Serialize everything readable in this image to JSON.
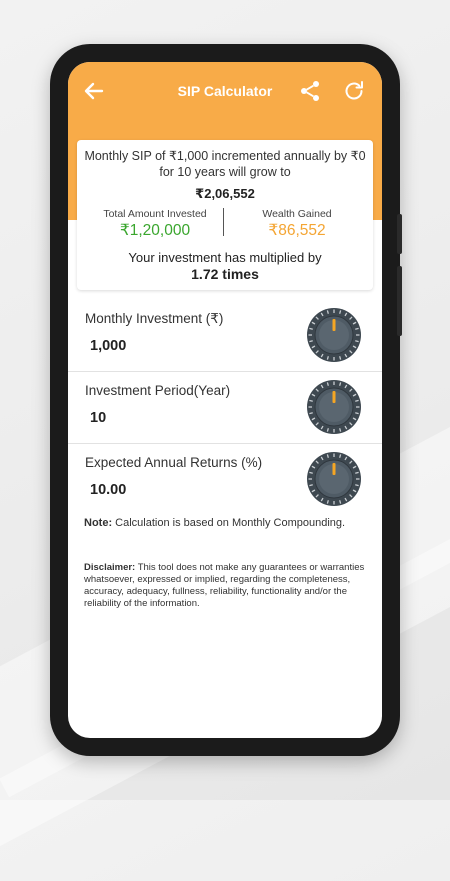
{
  "header": {
    "title": "SIP Calculator",
    "back_icon": "arrow-left-icon",
    "share_icon": "share-icon",
    "refresh_icon": "refresh-icon"
  },
  "summary": {
    "headline": "Monthly SIP of ₹1,000 incremented annually by ₹0 for 10 years will grow to",
    "total_value": "₹2,06,552",
    "invested_label": "Total Amount Invested",
    "invested_value": "₹1,20,000",
    "gained_label": "Wealth Gained",
    "gained_value": "₹86,552",
    "multiplier_label": "Your investment has multiplied by",
    "multiplier_value": "1.72 times"
  },
  "inputs": [
    {
      "label": "Monthly Investment (₹)",
      "value": "1,000"
    },
    {
      "label": "Investment Period(Year)",
      "value": "10"
    },
    {
      "label": "Expected Annual Returns (%)",
      "value": "10.00"
    }
  ],
  "note": {
    "prefix": "Note:",
    "text": " Calculation is based on Monthly Compounding."
  },
  "disclaimer": {
    "prefix": "Disclaimer:",
    "text": " This tool does not make any guarantees or warranties whatsoever, expressed or implied, regarding the completeness, accuracy, adequacy, fullness, reliability, functionality and/or the reliability of the information."
  },
  "colors": {
    "accent": "#f8ab48",
    "invested": "#3aa62e",
    "gained": "#f4a533",
    "dial": "#4f5b65",
    "dial_marker": "#f5a623"
  }
}
